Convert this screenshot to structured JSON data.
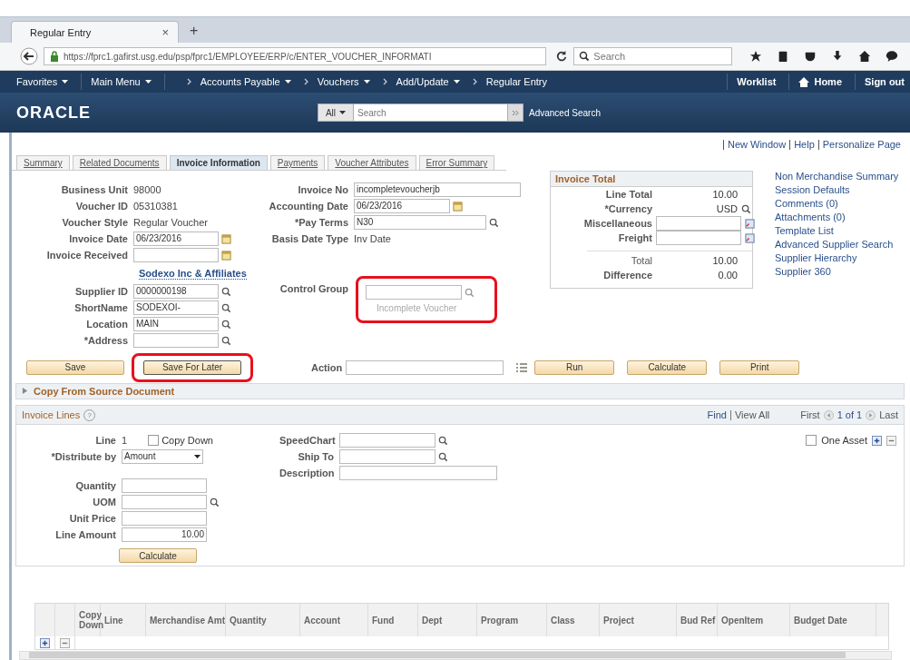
{
  "browser": {
    "tab_title": "Regular Entry",
    "tab_close": "×",
    "new_tab": "+",
    "url": "https://fprc1.gafirst.usg.edu/psp/fprc1/EMPLOYEE/ERP/c/ENTER_VOUCHER_INFORMATI",
    "search_placeholder": "Search"
  },
  "nav": {
    "items": [
      {
        "label": "Favorites",
        "dropdown": true,
        "crumb": false
      },
      {
        "label": "Main Menu",
        "dropdown": true,
        "crumb": false
      },
      {
        "label": "Accounts Payable",
        "dropdown": true,
        "crumb": true
      },
      {
        "label": "Vouchers",
        "dropdown": true,
        "crumb": true
      },
      {
        "label": "Add/Update",
        "dropdown": true,
        "crumb": true
      },
      {
        "label": "Regular Entry",
        "dropdown": false,
        "crumb": true
      }
    ],
    "right": [
      "Worklist",
      "Home",
      "Sign out"
    ]
  },
  "header": {
    "logo": "ORACLE",
    "scope": "All",
    "search_placeholder": "Search",
    "advanced": "Advanced Search"
  },
  "page_links": [
    "New Window",
    "Help",
    "Personalize Page"
  ],
  "tabs": [
    {
      "label": "Summary",
      "selected": false
    },
    {
      "label": "Related Documents",
      "selected": false
    },
    {
      "label": "Invoice Information",
      "selected": true
    },
    {
      "label": "Payments",
      "selected": false
    },
    {
      "label": "Voucher Attributes",
      "selected": false
    },
    {
      "label": "Error Summary",
      "selected": false
    }
  ],
  "left_fields": [
    {
      "label": "Business Unit",
      "kind": "text",
      "value": "98000"
    },
    {
      "label": "Voucher ID",
      "kind": "text",
      "value": "05310381"
    },
    {
      "label": "Voucher Style",
      "kind": "text",
      "value": "Regular Voucher"
    },
    {
      "label": "Invoice Date",
      "kind": "date",
      "value": "06/23/2016"
    },
    {
      "label": "Invoice Received",
      "kind": "date"
    },
    {
      "kind": "link",
      "value": "Sodexo Inc & Affiliates"
    },
    {
      "label": "Supplier ID",
      "kind": "lookup",
      "value": "0000000198"
    },
    {
      "label": "ShortName",
      "kind": "lookup",
      "value": "SODEXOI-"
    },
    {
      "label": "Location",
      "kind": "lookup",
      "value": "MAIN"
    },
    {
      "label": "*Address",
      "kind": "lookup"
    }
  ],
  "mid_fields": [
    {
      "label": "Invoice No",
      "kind": "input",
      "value": "incompletevoucherjb"
    },
    {
      "label": "Accounting Date",
      "kind": "date",
      "value": "06/23/2016"
    },
    {
      "label": "*Pay Terms",
      "kind": "lookup",
      "value": "N30"
    },
    {
      "label": "Basis Date Type",
      "kind": "text",
      "value": "Inv Date"
    }
  ],
  "control_group": {
    "label": "Control Group",
    "note": "Incomplete Voucher",
    "highlighted": true
  },
  "invoice_total": {
    "title": "Invoice Total",
    "rows": [
      {
        "label": "Line Total",
        "kind": "text",
        "value": "10.00"
      },
      {
        "label": "*Currency",
        "kind": "lookup",
        "value": "USD"
      },
      {
        "label": "Miscellaneous",
        "kind": "input"
      },
      {
        "label": "Freight",
        "kind": "input"
      },
      {
        "label": "Total",
        "kind": "total",
        "value": "10.00"
      },
      {
        "label": "Difference",
        "kind": "text",
        "value": "0.00"
      }
    ]
  },
  "side_links": [
    "Non Merchandise Summary",
    "Session Defaults",
    "Comments (0)",
    "Attachments (0)",
    "Template List",
    "Advanced Supplier Search",
    "Supplier Hierarchy",
    "Supplier 360"
  ],
  "actions": {
    "buttons": [
      {
        "label": "Save",
        "highlighted": false
      },
      {
        "label": "Save For Later",
        "highlighted": true
      }
    ],
    "action_label": "Action",
    "run": [
      "Run",
      "Calculate",
      "Print"
    ]
  },
  "copy_from": {
    "label": "Copy From Source Document",
    "expanded": false
  },
  "invoice_lines": {
    "title": "Invoice Lines",
    "help": "?",
    "find": "Find",
    "view_all": "View All",
    "first": "First",
    "count": "1 of 1",
    "last": "Last",
    "line_label": "Line",
    "line_no": "1",
    "copy_down": {
      "label": "Copy Down",
      "checked": false
    },
    "distribute_label": "*Distribute by",
    "distribute_value": "Amount",
    "fields": [
      {
        "label": "Quantity",
        "kind": "input"
      },
      {
        "label": "UOM",
        "kind": "lookup"
      },
      {
        "label": "Unit Price",
        "kind": "input"
      },
      {
        "label": "Line Amount",
        "kind": "input",
        "value": "10.00"
      }
    ],
    "calculate": "Calculate",
    "right_fields": [
      {
        "label": "SpeedChart",
        "kind": "lookup"
      },
      {
        "label": "Ship To",
        "kind": "lookup"
      },
      {
        "label": "Description",
        "kind": "input"
      }
    ],
    "one_asset": {
      "label": "One Asset",
      "checked": false
    }
  },
  "grid": {
    "columns": [
      "Copy Down",
      "Line",
      "Merchandise Amt",
      "Quantity",
      "Account",
      "Fund",
      "Dept",
      "Program",
      "Class",
      "Project",
      "Bud Ref",
      "OpenItem",
      "Budget Date"
    ]
  }
}
